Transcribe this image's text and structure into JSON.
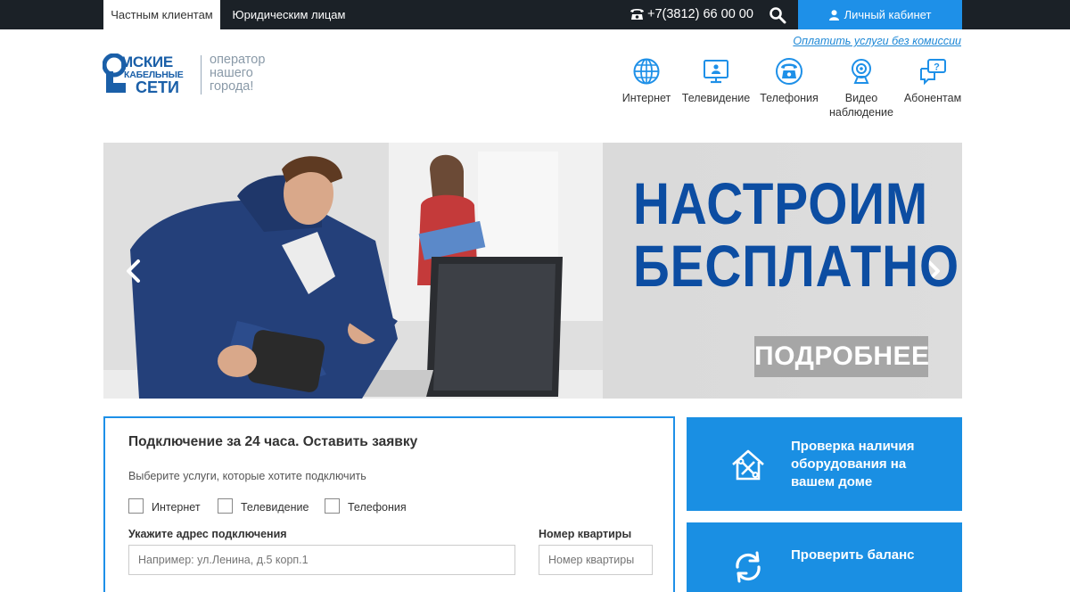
{
  "topbar": {
    "tab_private": "Частным клиентам",
    "tab_legal": "Юридическим лицам",
    "phone": "+7(3812) 66 00 00",
    "cabinet_label": "Личный кабинет"
  },
  "pay_link": "Оплатить услуги без комиссии",
  "logo": {
    "line1": "МСКИЕ",
    "line2": "КАБЕЛЬНЫЕ",
    "line3": "СЕТИ",
    "slogan": "оператор нашего города!"
  },
  "services": [
    {
      "label": "Интернет",
      "icon": "globe-icon"
    },
    {
      "label": "Телевидение",
      "icon": "tv-icon"
    },
    {
      "label": "Телефония",
      "icon": "phone-icon"
    },
    {
      "label": "Видео наблюдение",
      "icon": "webcam-icon"
    },
    {
      "label": "Абонентам",
      "icon": "chat-question-icon"
    }
  ],
  "banner": {
    "line1": "НАСТРОИМ",
    "line2": "БЕСПЛАТНО",
    "more": "ПОДРОБНЕЕ"
  },
  "form": {
    "title": "Подключение за 24 часа. Оставить заявку",
    "hint": "Выберите услуги, которые хотите подключить",
    "options": [
      "Интернет",
      "Телевидение",
      "Телефония"
    ],
    "address_label": "Укажите адрес подключения",
    "address_placeholder": "Например: ул.Ленина, д.5 корп.1",
    "apt_label": "Номер квартиры",
    "apt_placeholder": "Номер квартиры"
  },
  "side": {
    "check_equipment": "Проверка наличия оборудования на вашем доме",
    "check_balance": "Проверить баланс"
  },
  "colors": {
    "accent": "#1e90e8",
    "topbar": "#1b2127",
    "banner_text": "#0c4da2"
  }
}
